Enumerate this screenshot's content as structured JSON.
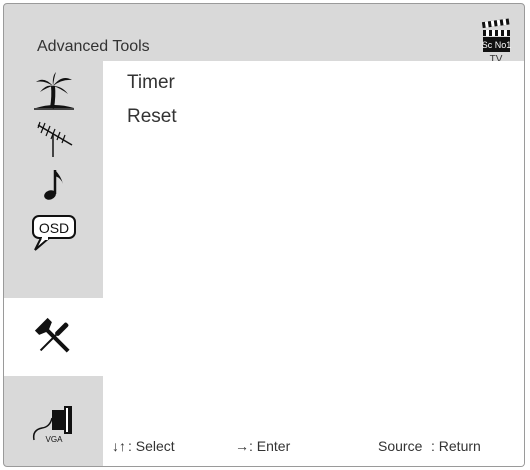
{
  "header": {
    "title": "Advanced Tools",
    "source_badge": {
      "icon": "clapperboard-icon",
      "label": "Sc No1",
      "sublabel": "TV"
    }
  },
  "sidebar": {
    "items": [
      {
        "icon": "palm-tree-icon",
        "active": false
      },
      {
        "icon": "antenna-icon",
        "active": false
      },
      {
        "icon": "music-note-icon",
        "active": false
      },
      {
        "icon": "osd-bubble-icon",
        "label": "OSD",
        "active": false
      },
      {
        "icon": "tools-icon",
        "active": true
      },
      {
        "icon": "vga-cable-icon",
        "label": "VGA",
        "active": false
      }
    ]
  },
  "menu": {
    "items": [
      {
        "label": "Timer"
      },
      {
        "label": "Reset"
      }
    ]
  },
  "footer": {
    "select_key": "↓↑",
    "select_label": ": Select",
    "enter_key": "→",
    "enter_label": ": Enter",
    "return_key": "Source",
    "return_label": ": Return"
  },
  "colors": {
    "panel_bg": "#d9d9d9",
    "content_bg": "#ffffff",
    "text": "#333333"
  }
}
